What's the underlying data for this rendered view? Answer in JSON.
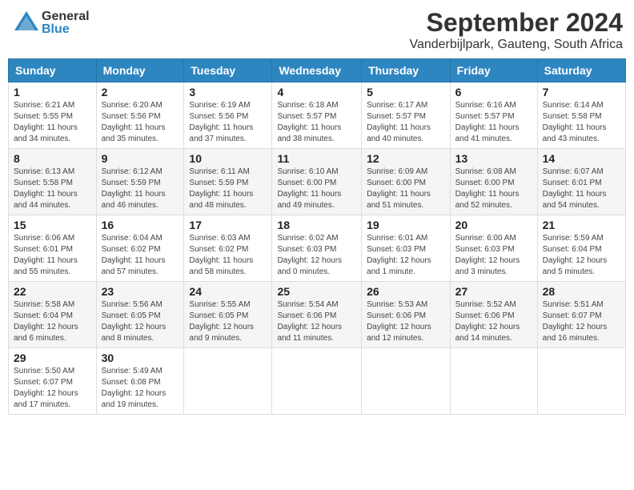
{
  "header": {
    "logo_general": "General",
    "logo_blue": "Blue",
    "month_year": "September 2024",
    "location": "Vanderbijlpark, Gauteng, South Africa"
  },
  "days_of_week": [
    "Sunday",
    "Monday",
    "Tuesday",
    "Wednesday",
    "Thursday",
    "Friday",
    "Saturday"
  ],
  "weeks": [
    [
      {
        "day": "1",
        "info": "Sunrise: 6:21 AM\nSunset: 5:55 PM\nDaylight: 11 hours\nand 34 minutes."
      },
      {
        "day": "2",
        "info": "Sunrise: 6:20 AM\nSunset: 5:56 PM\nDaylight: 11 hours\nand 35 minutes."
      },
      {
        "day": "3",
        "info": "Sunrise: 6:19 AM\nSunset: 5:56 PM\nDaylight: 11 hours\nand 37 minutes."
      },
      {
        "day": "4",
        "info": "Sunrise: 6:18 AM\nSunset: 5:57 PM\nDaylight: 11 hours\nand 38 minutes."
      },
      {
        "day": "5",
        "info": "Sunrise: 6:17 AM\nSunset: 5:57 PM\nDaylight: 11 hours\nand 40 minutes."
      },
      {
        "day": "6",
        "info": "Sunrise: 6:16 AM\nSunset: 5:57 PM\nDaylight: 11 hours\nand 41 minutes."
      },
      {
        "day": "7",
        "info": "Sunrise: 6:14 AM\nSunset: 5:58 PM\nDaylight: 11 hours\nand 43 minutes."
      }
    ],
    [
      {
        "day": "8",
        "info": "Sunrise: 6:13 AM\nSunset: 5:58 PM\nDaylight: 11 hours\nand 44 minutes."
      },
      {
        "day": "9",
        "info": "Sunrise: 6:12 AM\nSunset: 5:59 PM\nDaylight: 11 hours\nand 46 minutes."
      },
      {
        "day": "10",
        "info": "Sunrise: 6:11 AM\nSunset: 5:59 PM\nDaylight: 11 hours\nand 48 minutes."
      },
      {
        "day": "11",
        "info": "Sunrise: 6:10 AM\nSunset: 6:00 PM\nDaylight: 11 hours\nand 49 minutes."
      },
      {
        "day": "12",
        "info": "Sunrise: 6:09 AM\nSunset: 6:00 PM\nDaylight: 11 hours\nand 51 minutes."
      },
      {
        "day": "13",
        "info": "Sunrise: 6:08 AM\nSunset: 6:00 PM\nDaylight: 11 hours\nand 52 minutes."
      },
      {
        "day": "14",
        "info": "Sunrise: 6:07 AM\nSunset: 6:01 PM\nDaylight: 11 hours\nand 54 minutes."
      }
    ],
    [
      {
        "day": "15",
        "info": "Sunrise: 6:06 AM\nSunset: 6:01 PM\nDaylight: 11 hours\nand 55 minutes."
      },
      {
        "day": "16",
        "info": "Sunrise: 6:04 AM\nSunset: 6:02 PM\nDaylight: 11 hours\nand 57 minutes."
      },
      {
        "day": "17",
        "info": "Sunrise: 6:03 AM\nSunset: 6:02 PM\nDaylight: 11 hours\nand 58 minutes."
      },
      {
        "day": "18",
        "info": "Sunrise: 6:02 AM\nSunset: 6:03 PM\nDaylight: 12 hours\nand 0 minutes."
      },
      {
        "day": "19",
        "info": "Sunrise: 6:01 AM\nSunset: 6:03 PM\nDaylight: 12 hours\nand 1 minute."
      },
      {
        "day": "20",
        "info": "Sunrise: 6:00 AM\nSunset: 6:03 PM\nDaylight: 12 hours\nand 3 minutes."
      },
      {
        "day": "21",
        "info": "Sunrise: 5:59 AM\nSunset: 6:04 PM\nDaylight: 12 hours\nand 5 minutes."
      }
    ],
    [
      {
        "day": "22",
        "info": "Sunrise: 5:58 AM\nSunset: 6:04 PM\nDaylight: 12 hours\nand 6 minutes."
      },
      {
        "day": "23",
        "info": "Sunrise: 5:56 AM\nSunset: 6:05 PM\nDaylight: 12 hours\nand 8 minutes."
      },
      {
        "day": "24",
        "info": "Sunrise: 5:55 AM\nSunset: 6:05 PM\nDaylight: 12 hours\nand 9 minutes."
      },
      {
        "day": "25",
        "info": "Sunrise: 5:54 AM\nSunset: 6:06 PM\nDaylight: 12 hours\nand 11 minutes."
      },
      {
        "day": "26",
        "info": "Sunrise: 5:53 AM\nSunset: 6:06 PM\nDaylight: 12 hours\nand 12 minutes."
      },
      {
        "day": "27",
        "info": "Sunrise: 5:52 AM\nSunset: 6:06 PM\nDaylight: 12 hours\nand 14 minutes."
      },
      {
        "day": "28",
        "info": "Sunrise: 5:51 AM\nSunset: 6:07 PM\nDaylight: 12 hours\nand 16 minutes."
      }
    ],
    [
      {
        "day": "29",
        "info": "Sunrise: 5:50 AM\nSunset: 6:07 PM\nDaylight: 12 hours\nand 17 minutes."
      },
      {
        "day": "30",
        "info": "Sunrise: 5:49 AM\nSunset: 6:08 PM\nDaylight: 12 hours\nand 19 minutes."
      },
      {
        "day": "",
        "info": ""
      },
      {
        "day": "",
        "info": ""
      },
      {
        "day": "",
        "info": ""
      },
      {
        "day": "",
        "info": ""
      },
      {
        "day": "",
        "info": ""
      }
    ]
  ]
}
